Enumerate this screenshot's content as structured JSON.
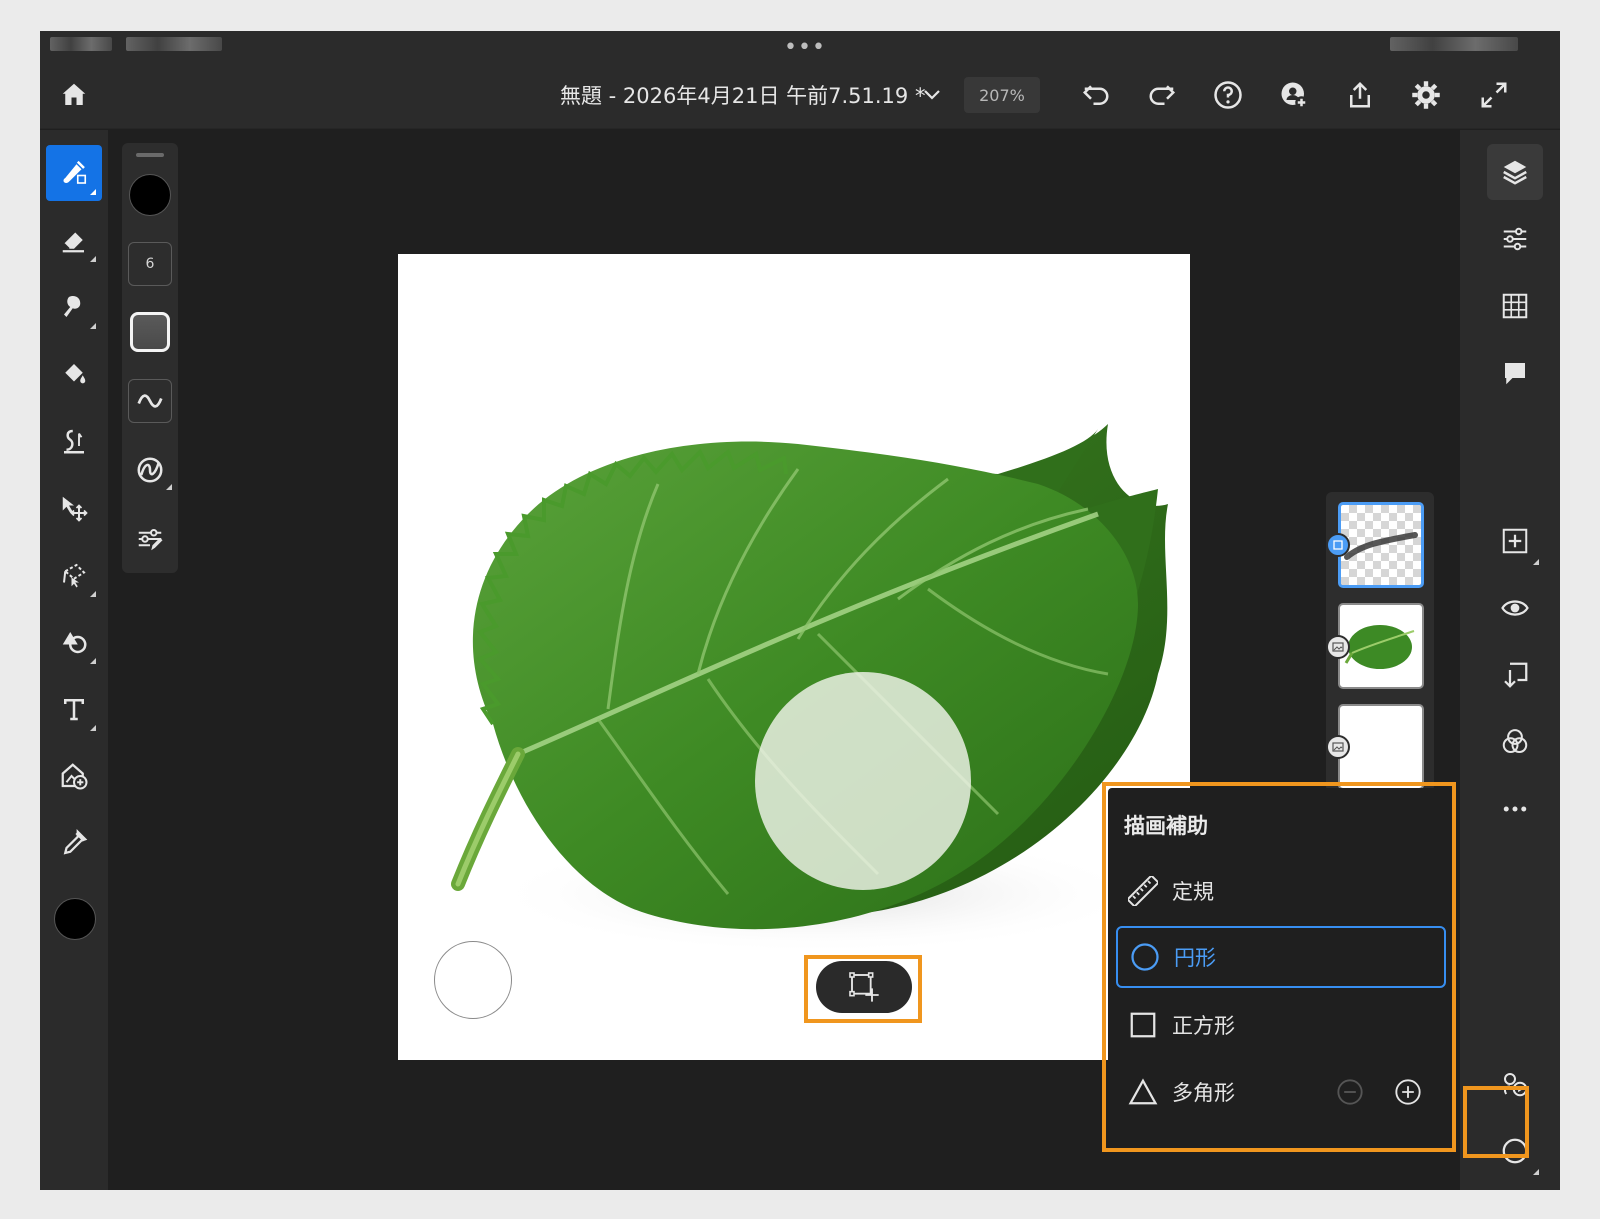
{
  "document": {
    "title": "無題 - 2026年4月21日 午前7.51.19 *",
    "zoom": "207%"
  },
  "brush": {
    "size": "6"
  },
  "drawing_assist": {
    "title": "描画補助",
    "items": [
      {
        "label": "定規",
        "icon": "ruler-icon",
        "selected": false
      },
      {
        "label": "円形",
        "icon": "circle-icon",
        "selected": true
      },
      {
        "label": "正方形",
        "icon": "square-icon",
        "selected": false
      },
      {
        "label": "多角形",
        "icon": "triangle-icon",
        "selected": false
      }
    ]
  },
  "colors": {
    "accent": "#1473e6",
    "highlight": "#f0961e",
    "selected_text": "#4b9cf5",
    "foreground_color": "#000000"
  }
}
